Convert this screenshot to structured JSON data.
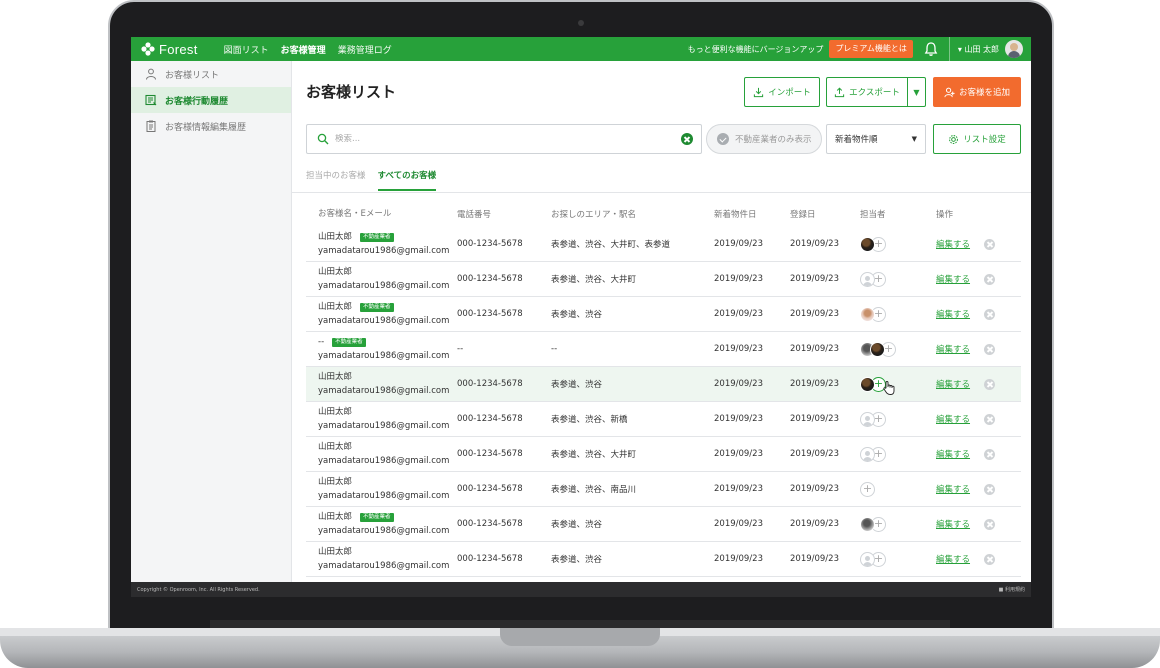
{
  "app": {
    "logo": "Forest",
    "nav": [
      "図面リスト",
      "お客様管理",
      "業務管理ログ"
    ],
    "nav_active": 1,
    "upgrade_text": "もっと便利な機能にバージョンアップ",
    "premium_label": "プレミアム機能とは",
    "user_name": "▾ 山田 太郎"
  },
  "sidebar": {
    "items": [
      {
        "label": "お客様リスト",
        "icon": "user-icon"
      },
      {
        "label": "お客様行動履歴",
        "icon": "list-icon"
      },
      {
        "label": "お客様情報編集履歴",
        "icon": "clipboard-icon"
      }
    ],
    "active": 1
  },
  "main": {
    "title": "お客様リスト",
    "import_label": "インポート",
    "export_label": "エクスポート",
    "add_label": "お客様を追加",
    "search_placeholder": "検索...",
    "filter_label": "不動産業者のみ表示",
    "sort_value": "新着物件順",
    "list_settings_label": "リスト設定",
    "tabs": [
      "担当中のお客様",
      "すべてのお客様"
    ],
    "active_tab": 1
  },
  "table": {
    "headers": [
      "お客様名・Eメール",
      "電話番号",
      "お探しのエリア・駅名",
      "新着物件日",
      "登録日",
      "担当者",
      "操作"
    ],
    "badge_label": "不動産業者",
    "edit_label": "編集する",
    "rows": [
      {
        "name": "山田太郎",
        "email": "yamadatarou1986@gmail.com",
        "badge": true,
        "phone": "000-1234-5678",
        "area": "表参道、渋谷、大井町、表参道",
        "new_date": "2019/09/23",
        "reg_date": "2019/09/23",
        "assignees": [
          "dark"
        ]
      },
      {
        "name": "山田太郎",
        "email": "yamadatarou1986@gmail.com",
        "badge": false,
        "phone": "000-1234-5678",
        "area": "表参道、渋谷、大井町",
        "new_date": "2019/09/23",
        "reg_date": "2019/09/23",
        "assignees": [
          "gray"
        ]
      },
      {
        "name": "山田太郎",
        "email": "yamadatarou1986@gmail.com",
        "badge": true,
        "phone": "000-1234-5678",
        "area": "表参道、渋谷",
        "new_date": "2019/09/23",
        "reg_date": "2019/09/23",
        "assignees": [
          "light"
        ]
      },
      {
        "name": "--",
        "email": "yamadatarou1986@gmail.com",
        "badge": true,
        "phone": "--",
        "area": "--",
        "new_date": "2019/09/23",
        "reg_date": "2019/09/23",
        "assignees": [
          "mix",
          "dark"
        ]
      },
      {
        "name": "山田太郎",
        "email": "yamadatarou1986@gmail.com",
        "badge": false,
        "phone": "000-1234-5678",
        "area": "表参道、渋谷",
        "new_date": "2019/09/23",
        "reg_date": "2019/09/23",
        "assignees": [
          "dark"
        ],
        "hover": true
      },
      {
        "name": "山田太郎",
        "email": "yamadatarou1986@gmail.com",
        "badge": false,
        "phone": "000-1234-5678",
        "area": "表参道、渋谷、新橋",
        "new_date": "2019/09/23",
        "reg_date": "2019/09/23",
        "assignees": [
          "gray"
        ]
      },
      {
        "name": "山田太郎",
        "email": "yamadatarou1986@gmail.com",
        "badge": false,
        "phone": "000-1234-5678",
        "area": "表参道、渋谷、大井町",
        "new_date": "2019/09/23",
        "reg_date": "2019/09/23",
        "assignees": [
          "gray"
        ]
      },
      {
        "name": "山田太郎",
        "email": "yamadatarou1986@gmail.com",
        "badge": false,
        "phone": "000-1234-5678",
        "area": "表参道、渋谷、南品川",
        "new_date": "2019/09/23",
        "reg_date": "2019/09/23",
        "assignees": []
      },
      {
        "name": "山田太郎",
        "email": "yamadatarou1986@gmail.com",
        "badge": true,
        "phone": "000-1234-5678",
        "area": "表参道、渋谷",
        "new_date": "2019/09/23",
        "reg_date": "2019/09/23",
        "assignees": [
          "mix"
        ]
      },
      {
        "name": "山田太郎",
        "email": "yamadatarou1986@gmail.com",
        "badge": false,
        "phone": "000-1234-5678",
        "area": "表参道、渋谷",
        "new_date": "2019/09/23",
        "reg_date": "2019/09/23",
        "assignees": [
          "gray"
        ]
      }
    ]
  },
  "footer": {
    "copyright": "Copyright © Openroom, Inc. All Rights Reserved.",
    "terms": "■ 利用規約"
  },
  "colors": {
    "brand": "#27a13a",
    "accent": "#f26b2e"
  }
}
